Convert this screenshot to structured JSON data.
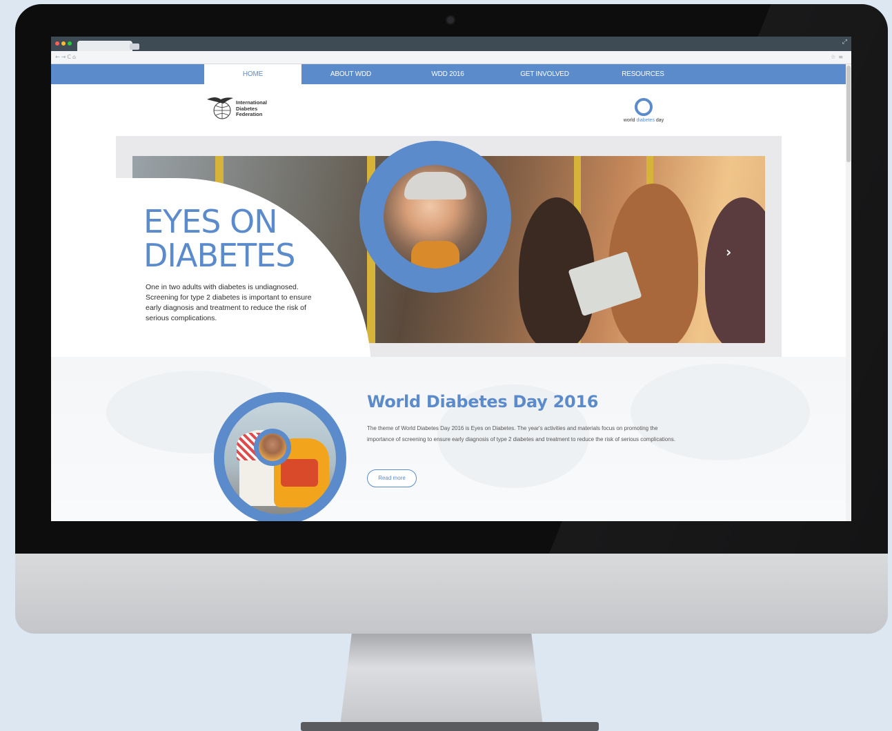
{
  "nav": {
    "items": [
      {
        "label": "HOME",
        "active": true
      },
      {
        "label": "ABOUT WDD",
        "active": false
      },
      {
        "label": "WDD 2016",
        "active": false
      },
      {
        "label": "GET INVOLVED",
        "active": false
      },
      {
        "label": "RESOURCES",
        "active": false
      }
    ]
  },
  "header": {
    "idf_logo": {
      "line1": "International",
      "line2": "Diabetes",
      "line3": "Federation"
    },
    "wdd_logo": {
      "word1": "world",
      "word2": "diabetes",
      "word3": "day"
    }
  },
  "hero": {
    "title_line1": "EYES ON",
    "title_line2": "DIABETES",
    "description": "One in two adults with diabetes is undiagnosed. Screening for type 2 diabetes is important to ensure early diagnosis and treatment to reduce the risk of serious complications.",
    "next_icon": "chevron-right-icon"
  },
  "section": {
    "title": "World Diabetes Day 2016",
    "text": "The theme of World Diabetes Day 2016 is Eyes on Diabetes. The year's activities and materials focus on promoting the importance of screening to ensure early diagnosis of type 2 diabetes and treatment to reduce the risk of serious complications.",
    "button_label": "Read more"
  },
  "colors": {
    "brand_blue": "#5b8bcb",
    "page_background": "#dde7f2",
    "bezel": "#0d0d0e"
  }
}
